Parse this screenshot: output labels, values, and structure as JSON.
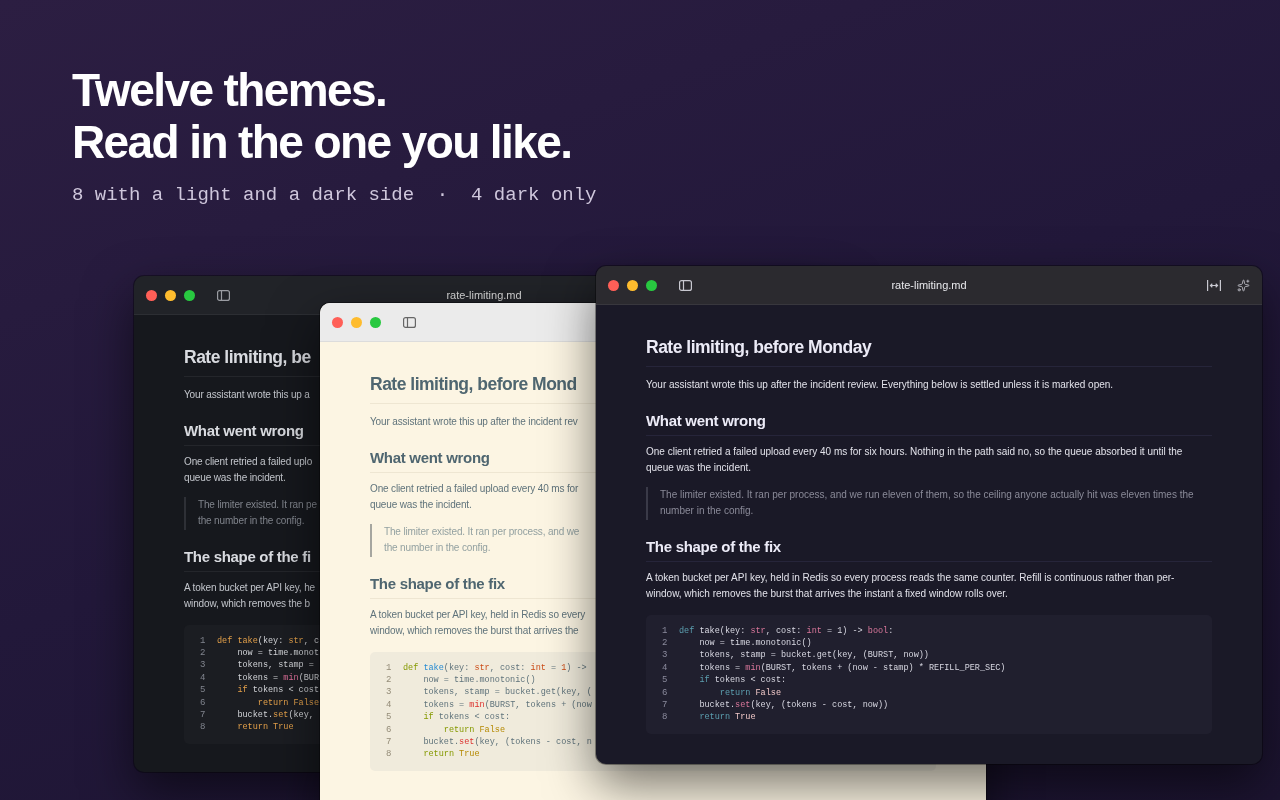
{
  "hero": {
    "title_lines": [
      "Twelve themes.",
      "Read in the one you like."
    ],
    "subtitle": "8 with a light and a dark side  ·  4 dark only"
  },
  "windows": [
    {
      "kind": "graphite",
      "title": "rate-limiting.md",
      "blocks": [
        {
          "kind": "h1",
          "lines": [
            "Rate limiting, be"
          ]
        },
        {
          "kind": "p",
          "lines": [
            "Your assistant wrote this up a"
          ]
        },
        {
          "kind": "h2",
          "lines": [
            "What went wrong"
          ]
        },
        {
          "kind": "p",
          "lines": [
            "One client retried a failed uplo",
            "queue was the incident."
          ]
        },
        {
          "kind": "quote",
          "lines": [
            "The limiter existed. It ran pe",
            "the number in the config."
          ]
        },
        {
          "kind": "h2",
          "lines": [
            "The shape of the fi"
          ]
        },
        {
          "kind": "p",
          "lines": [
            "A token bucket per API key, he",
            "window, which removes the b"
          ]
        },
        {
          "kind": "code",
          "code": [
            {
              "number": "1",
              "tokens": [
                {
                  "kind": "kw",
                  "t": "def "
                },
                {
                  "kind": "fn",
                  "t": "take"
                },
                {
                  "kind": "plain",
                  "t": "(key: "
                },
                {
                  "kind": "type",
                  "t": "str"
                },
                {
                  "kind": "plain",
                  "t": ", c"
                }
              ]
            },
            {
              "number": "2",
              "tokens": [
                {
                  "kind": "plain",
                  "t": "    now = time.monot"
                }
              ]
            },
            {
              "number": "3",
              "tokens": [
                {
                  "kind": "plain",
                  "t": "    tokens, stamp ="
                }
              ]
            },
            {
              "number": "4",
              "tokens": [
                {
                  "kind": "plain",
                  "t": "    tokens = "
                },
                {
                  "kind": "builtin",
                  "t": "min"
                },
                {
                  "kind": "plain",
                  "t": "(BUR"
                }
              ]
            },
            {
              "number": "5",
              "tokens": [
                {
                  "kind": "kw",
                  "t": "    if"
                },
                {
                  "kind": "plain",
                  "t": " tokens < cost"
                }
              ]
            },
            {
              "number": "6",
              "tokens": [
                {
                  "kind": "kw",
                  "t": "        return "
                },
                {
                  "kind": "lit",
                  "t": "False"
                }
              ]
            },
            {
              "number": "7",
              "tokens": [
                {
                  "kind": "plain",
                  "t": "    bucket."
                },
                {
                  "kind": "call",
                  "t": "set"
                },
                {
                  "kind": "plain",
                  "t": "(key,"
                }
              ]
            },
            {
              "number": "8",
              "tokens": [
                {
                  "kind": "kw",
                  "t": "    return "
                },
                {
                  "kind": "lit",
                  "t": "True"
                }
              ]
            }
          ]
        }
      ]
    },
    {
      "kind": "solar",
      "blocks": [
        {
          "kind": "h1",
          "lines": [
            "Rate limiting, before Mond"
          ]
        },
        {
          "kind": "p",
          "lines": [
            "Your assistant wrote this up after the incident rev"
          ]
        },
        {
          "kind": "h2",
          "lines": [
            "What went wrong"
          ]
        },
        {
          "kind": "p",
          "lines": [
            "One client retried a failed upload every 40 ms for",
            "queue was the incident."
          ]
        },
        {
          "kind": "quote",
          "lines": [
            "The limiter existed. It ran per process, and we",
            "the number in the config."
          ]
        },
        {
          "kind": "h2",
          "lines": [
            "The shape of the fix"
          ]
        },
        {
          "kind": "p",
          "lines": [
            "A token bucket per API key, held in Redis so every",
            "window, which removes the burst that arrives the"
          ]
        },
        {
          "kind": "code",
          "code": [
            {
              "number": "1",
              "tokens": [
                {
                  "kind": "kw",
                  "t": "def "
                },
                {
                  "kind": "fn",
                  "t": "take"
                },
                {
                  "kind": "plain",
                  "t": "(key: "
                },
                {
                  "kind": "type",
                  "t": "str"
                },
                {
                  "kind": "plain",
                  "t": ", cost: "
                },
                {
                  "kind": "type",
                  "t": "int"
                },
                {
                  "kind": "plain",
                  "t": " = "
                },
                {
                  "kind": "num",
                  "t": "1"
                },
                {
                  "kind": "plain",
                  "t": ") ->"
                }
              ]
            },
            {
              "number": "2",
              "tokens": [
                {
                  "kind": "plain",
                  "t": "    now = time.monotonic()"
                }
              ]
            },
            {
              "number": "3",
              "tokens": [
                {
                  "kind": "plain",
                  "t": "    tokens, stamp = bucket.get(key, ("
                }
              ]
            },
            {
              "number": "4",
              "tokens": [
                {
                  "kind": "plain",
                  "t": "    tokens = "
                },
                {
                  "kind": "builtin",
                  "t": "min"
                },
                {
                  "kind": "plain",
                  "t": "(BURST, tokens + (now"
                }
              ]
            },
            {
              "number": "5",
              "tokens": [
                {
                  "kind": "kw",
                  "t": "    if"
                },
                {
                  "kind": "plain",
                  "t": " tokens < cost:"
                }
              ]
            },
            {
              "number": "6",
              "tokens": [
                {
                  "kind": "kw",
                  "t": "        return "
                },
                {
                  "kind": "lit",
                  "t": "False"
                }
              ]
            },
            {
              "number": "7",
              "tokens": [
                {
                  "kind": "plain",
                  "t": "    bucket."
                },
                {
                  "kind": "call",
                  "t": "set"
                },
                {
                  "kind": "plain",
                  "t": "(key, (tokens - cost, n"
                }
              ]
            },
            {
              "number": "8",
              "tokens": [
                {
                  "kind": "kw",
                  "t": "    return "
                },
                {
                  "kind": "lit",
                  "t": "True"
                }
              ]
            }
          ]
        }
      ]
    },
    {
      "kind": "midnight",
      "title": "rate-limiting.md",
      "has_actions": true,
      "blocks": [
        {
          "kind": "h1",
          "lines": [
            "Rate limiting, before Monday"
          ]
        },
        {
          "kind": "p",
          "lines": [
            "Your assistant wrote this up after the incident review. Everything below is settled unless it is marked open."
          ]
        },
        {
          "kind": "h2",
          "lines": [
            "What went wrong"
          ]
        },
        {
          "kind": "p",
          "lines": [
            "One client retried a failed upload every 40 ms for six hours. Nothing in the path said no, so the queue absorbed it until the queue was the incident."
          ]
        },
        {
          "kind": "quote",
          "lines": [
            "The limiter existed. It ran per process, and we run eleven of them, so the ceiling anyone actually hit was eleven times the number in the config."
          ]
        },
        {
          "kind": "h2",
          "lines": [
            "The shape of the fix"
          ]
        },
        {
          "kind": "p",
          "lines": [
            "A token bucket per API key, held in Redis so every process reads the same counter. Refill is continuous rather than per-window, which removes the burst that arrives the instant a fixed window rolls over."
          ]
        },
        {
          "kind": "code",
          "code": [
            {
              "number": "1",
              "tokens": [
                {
                  "kind": "kw",
                  "t": "def "
                },
                {
                  "kind": "fn",
                  "t": "take"
                },
                {
                  "kind": "plain",
                  "t": "(key: "
                },
                {
                  "kind": "type",
                  "t": "str"
                },
                {
                  "kind": "plain",
                  "t": ", cost: "
                },
                {
                  "kind": "type",
                  "t": "int"
                },
                {
                  "kind": "plain",
                  "t": " = 1) -> "
                },
                {
                  "kind": "type",
                  "t": "bool"
                },
                {
                  "kind": "plain",
                  "t": ":"
                }
              ]
            },
            {
              "number": "2",
              "tokens": [
                {
                  "kind": "plain",
                  "t": "    now = time.monotonic()"
                }
              ]
            },
            {
              "number": "3",
              "tokens": [
                {
                  "kind": "plain",
                  "t": "    tokens, stamp = bucket.get(key, (BURST, now))"
                }
              ]
            },
            {
              "number": "4",
              "tokens": [
                {
                  "kind": "plain",
                  "t": "    tokens = "
                },
                {
                  "kind": "builtin",
                  "t": "min"
                },
                {
                  "kind": "plain",
                  "t": "(BURST, tokens + (now - stamp) * REFILL_PER_SEC)"
                }
              ]
            },
            {
              "number": "5",
              "tokens": [
                {
                  "kind": "kw",
                  "t": "    if"
                },
                {
                  "kind": "plain",
                  "t": " tokens < cost:"
                }
              ]
            },
            {
              "number": "6",
              "tokens": [
                {
                  "kind": "kw",
                  "t": "        return "
                },
                {
                  "kind": "lit",
                  "t": "False"
                }
              ]
            },
            {
              "number": "7",
              "tokens": [
                {
                  "kind": "plain",
                  "t": "    bucket."
                },
                {
                  "kind": "call",
                  "t": "set"
                },
                {
                  "kind": "plain",
                  "t": "(key, (tokens - cost, now))"
                }
              ]
            },
            {
              "number": "8",
              "tokens": [
                {
                  "kind": "kw",
                  "t": "    return "
                },
                {
                  "kind": "lit",
                  "t": "True"
                }
              ]
            }
          ]
        }
      ]
    }
  ]
}
